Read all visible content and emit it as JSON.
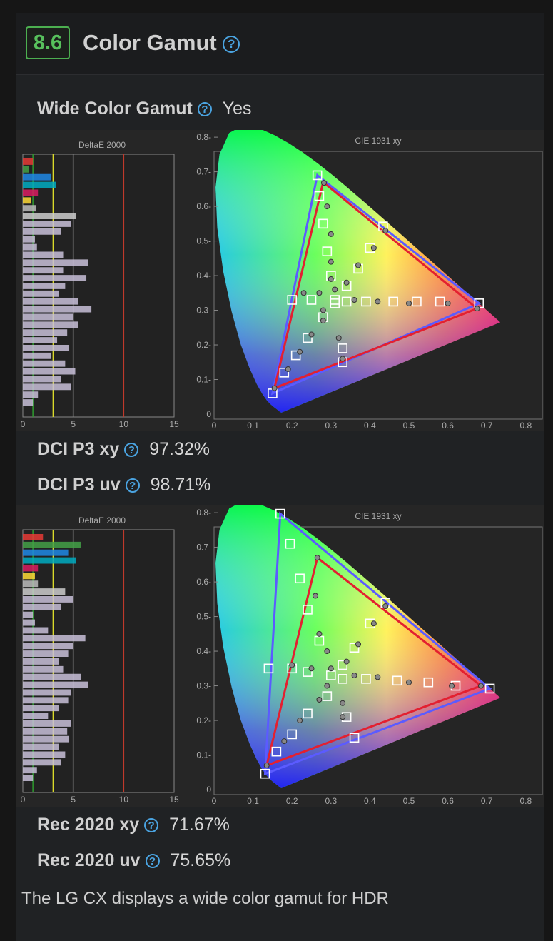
{
  "section": {
    "score": "8.6",
    "title": "Color Gamut",
    "help": "?"
  },
  "wide_color_gamut": {
    "label": "Wide Color Gamut",
    "value": "Yes"
  },
  "metrics": {
    "dci_p3_xy": {
      "label": "DCI P3 xy",
      "value": "97.32%"
    },
    "dci_p3_uv": {
      "label": "DCI P3 uv",
      "value": "98.71%"
    },
    "rec2020_xy": {
      "label": "Rec 2020 xy",
      "value": "71.67%"
    },
    "rec2020_uv": {
      "label": "Rec 2020 uv",
      "value": "75.65%"
    }
  },
  "description": "The LG CX displays a wide color gamut for HDR",
  "charts": {
    "delta_title": "DeltaE 2000",
    "cie_title": "CIE 1931 xy",
    "delta_ticks": [
      "0",
      "5",
      "10",
      "15"
    ],
    "cie_xticks": [
      "0",
      "0.1",
      "0.2",
      "0.3",
      "0.4",
      "0.5",
      "0.6",
      "0.7",
      "0.8"
    ],
    "cie_yticks": [
      "0",
      "0.1",
      "0.2",
      "0.3",
      "0.4",
      "0.5",
      "0.6",
      "0.7",
      "0.8"
    ]
  },
  "chart_data": [
    {
      "type": "bar",
      "title": "DeltaE 2000",
      "xlim": [
        0,
        15
      ],
      "reference_lines": [
        {
          "value": 1,
          "color": "#2e9a2e"
        },
        {
          "value": 3,
          "color": "#d9d92a"
        },
        {
          "value": 5,
          "color": "#8a8a8a"
        },
        {
          "value": 10,
          "color": "#c0392b"
        }
      ],
      "values": [
        1.0,
        0.6,
        2.8,
        3.3,
        1.5,
        0.8,
        1.3,
        5.3,
        4.8,
        3.8,
        1.2,
        1.4,
        4.0,
        6.5,
        4.0,
        6.3,
        4.2,
        3.6,
        5.5,
        6.8,
        5.0,
        5.5,
        4.4,
        3.4,
        4.6,
        2.8,
        4.2,
        5.2,
        3.8,
        4.8,
        1.5,
        1.0
      ]
    },
    {
      "type": "scatter",
      "title": "CIE 1931 xy",
      "xlim": [
        0,
        0.8
      ],
      "ylim": [
        0,
        0.8
      ],
      "target_gamut": "DCI P3",
      "target_triangle": [
        [
          0.68,
          0.32
        ],
        [
          0.265,
          0.69
        ],
        [
          0.15,
          0.06
        ]
      ],
      "measured_triangle": [
        [
          0.675,
          0.305
        ],
        [
          0.28,
          0.67
        ],
        [
          0.155,
          0.075
        ]
      ],
      "targets": [
        [
          0.265,
          0.69
        ],
        [
          0.27,
          0.63
        ],
        [
          0.28,
          0.55
        ],
        [
          0.29,
          0.47
        ],
        [
          0.3,
          0.4
        ],
        [
          0.31,
          0.33
        ],
        [
          0.434,
          0.542
        ],
        [
          0.4,
          0.48
        ],
        [
          0.37,
          0.42
        ],
        [
          0.34,
          0.37
        ],
        [
          0.68,
          0.32
        ],
        [
          0.58,
          0.325
        ],
        [
          0.52,
          0.325
        ],
        [
          0.46,
          0.325
        ],
        [
          0.39,
          0.325
        ],
        [
          0.34,
          0.325
        ],
        [
          0.15,
          0.06
        ],
        [
          0.18,
          0.12
        ],
        [
          0.21,
          0.17
        ],
        [
          0.24,
          0.22
        ],
        [
          0.28,
          0.28
        ],
        [
          0.33,
          0.15
        ],
        [
          0.33,
          0.19
        ],
        [
          0.2,
          0.33
        ],
        [
          0.25,
          0.33
        ],
        [
          0.31,
          0.32
        ]
      ],
      "measured": [
        [
          0.282,
          0.668
        ],
        [
          0.29,
          0.6
        ],
        [
          0.3,
          0.52
        ],
        [
          0.3,
          0.44
        ],
        [
          0.3,
          0.39
        ],
        [
          0.31,
          0.36
        ],
        [
          0.44,
          0.53
        ],
        [
          0.41,
          0.48
        ],
        [
          0.37,
          0.43
        ],
        [
          0.34,
          0.38
        ],
        [
          0.675,
          0.305
        ],
        [
          0.6,
          0.32
        ],
        [
          0.5,
          0.32
        ],
        [
          0.42,
          0.325
        ],
        [
          0.36,
          0.33
        ],
        [
          0.155,
          0.075
        ],
        [
          0.19,
          0.13
        ],
        [
          0.22,
          0.18
        ],
        [
          0.25,
          0.23
        ],
        [
          0.28,
          0.27
        ],
        [
          0.33,
          0.16
        ],
        [
          0.32,
          0.22
        ],
        [
          0.23,
          0.35
        ],
        [
          0.27,
          0.35
        ],
        [
          0.28,
          0.3
        ]
      ]
    },
    {
      "type": "bar",
      "title": "DeltaE 2000",
      "xlim": [
        0,
        15
      ],
      "reference_lines": [
        {
          "value": 1,
          "color": "#2e9a2e"
        },
        {
          "value": 3,
          "color": "#d9d92a"
        },
        {
          "value": 5,
          "color": "#8a8a8a"
        },
        {
          "value": 10,
          "color": "#c0392b"
        }
      ],
      "values": [
        2.0,
        5.8,
        4.5,
        5.3,
        1.5,
        1.2,
        1.5,
        4.2,
        5.0,
        3.8,
        1.0,
        1.2,
        2.5,
        6.2,
        5.0,
        4.5,
        3.6,
        4.0,
        5.8,
        6.5,
        4.8,
        4.5,
        3.6,
        2.5,
        4.8,
        4.4,
        4.6,
        3.6,
        4.2,
        3.8,
        1.4,
        1.0
      ]
    },
    {
      "type": "scatter",
      "title": "CIE 1931 xy",
      "xlim": [
        0,
        0.8
      ],
      "ylim": [
        0,
        0.8
      ],
      "target_gamut": "Rec 2020",
      "target_triangle": [
        [
          0.708,
          0.292
        ],
        [
          0.17,
          0.797
        ],
        [
          0.131,
          0.046
        ]
      ],
      "measured_triangle": [
        [
          0.685,
          0.3
        ],
        [
          0.265,
          0.67
        ],
        [
          0.135,
          0.07
        ]
      ],
      "targets": [
        [
          0.17,
          0.797
        ],
        [
          0.195,
          0.71
        ],
        [
          0.22,
          0.61
        ],
        [
          0.24,
          0.52
        ],
        [
          0.27,
          0.43
        ],
        [
          0.3,
          0.33
        ],
        [
          0.44,
          0.54
        ],
        [
          0.4,
          0.48
        ],
        [
          0.36,
          0.41
        ],
        [
          0.33,
          0.36
        ],
        [
          0.708,
          0.292
        ],
        [
          0.62,
          0.3
        ],
        [
          0.55,
          0.31
        ],
        [
          0.47,
          0.315
        ],
        [
          0.39,
          0.32
        ],
        [
          0.33,
          0.32
        ],
        [
          0.131,
          0.046
        ],
        [
          0.16,
          0.11
        ],
        [
          0.2,
          0.16
        ],
        [
          0.24,
          0.22
        ],
        [
          0.29,
          0.27
        ],
        [
          0.36,
          0.15
        ],
        [
          0.34,
          0.21
        ],
        [
          0.14,
          0.35
        ],
        [
          0.2,
          0.35
        ],
        [
          0.24,
          0.34
        ]
      ],
      "measured": [
        [
          0.265,
          0.67
        ],
        [
          0.26,
          0.56
        ],
        [
          0.27,
          0.45
        ],
        [
          0.29,
          0.4
        ],
        [
          0.3,
          0.35
        ],
        [
          0.44,
          0.53
        ],
        [
          0.41,
          0.48
        ],
        [
          0.37,
          0.42
        ],
        [
          0.34,
          0.37
        ],
        [
          0.685,
          0.3
        ],
        [
          0.61,
          0.3
        ],
        [
          0.5,
          0.31
        ],
        [
          0.42,
          0.325
        ],
        [
          0.36,
          0.33
        ],
        [
          0.135,
          0.07
        ],
        [
          0.18,
          0.14
        ],
        [
          0.22,
          0.2
        ],
        [
          0.27,
          0.26
        ],
        [
          0.29,
          0.3
        ],
        [
          0.33,
          0.21
        ],
        [
          0.33,
          0.25
        ],
        [
          0.2,
          0.36
        ],
        [
          0.25,
          0.35
        ]
      ]
    }
  ]
}
